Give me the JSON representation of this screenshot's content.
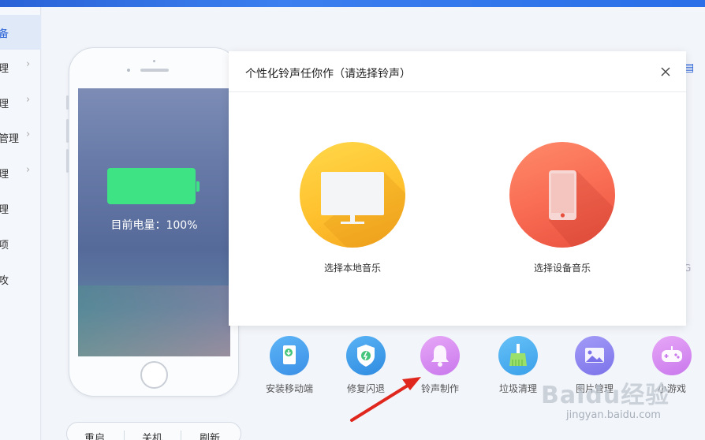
{
  "sidebar": {
    "items": [
      {
        "label": "备"
      },
      {
        "label": "理"
      },
      {
        "label": "理"
      },
      {
        "label": "管理"
      },
      {
        "label": "理"
      },
      {
        "label": "理"
      },
      {
        "label": "项"
      },
      {
        "label": "攻"
      }
    ]
  },
  "device": {
    "battery_text": "目前电量：100%",
    "battery_level": 1.0,
    "battery_color": "#3ee383"
  },
  "controls": {
    "restart": "重启",
    "shutdown": "关机",
    "refresh": "刷新"
  },
  "modal": {
    "title": "个性化铃声任你作（请选择铃声）",
    "options": [
      {
        "label": "选择本地音乐",
        "icon": "monitor-icon",
        "color": "#ffc12e"
      },
      {
        "label": "选择设备音乐",
        "icon": "phone-icon",
        "color": "#f86a52"
      }
    ]
  },
  "tools": [
    {
      "label": "安装移动端",
      "icon": "install-mobile-icon",
      "color": "#4aa3f0"
    },
    {
      "label": "修复闪退",
      "icon": "repair-shield-icon",
      "color": "#3f9fe8"
    },
    {
      "label": "铃声制作",
      "icon": "bell-icon",
      "color": "#d98ef0"
    },
    {
      "label": "垃圾清理",
      "icon": "broom-icon",
      "color": "#4ab6f2"
    },
    {
      "label": "图片管理",
      "icon": "picture-icon",
      "color": "#8e86f0"
    },
    {
      "label": "小游戏",
      "icon": "gamepad-icon",
      "color": "#d98ef0"
    }
  ],
  "watermark": {
    "brand": "Baidu经验",
    "url": "jingyan.baidu.com"
  }
}
